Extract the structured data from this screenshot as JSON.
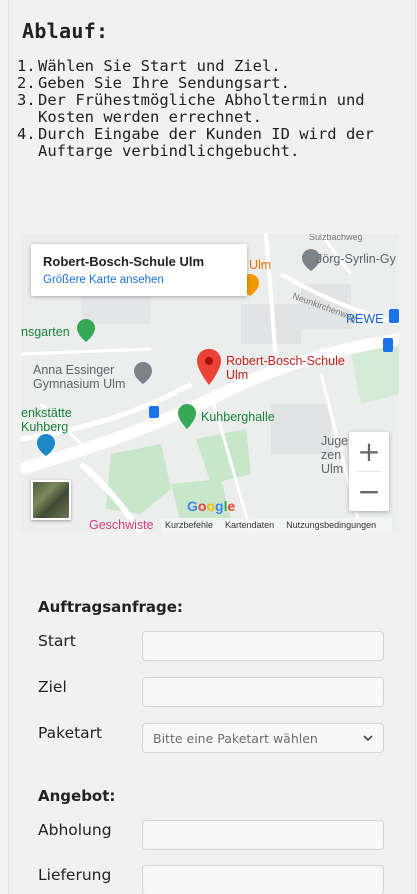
{
  "ablauf": {
    "title": "Ablauf:",
    "steps": [
      {
        "num": "1.",
        "text": "Wählen Sie Start und Ziel."
      },
      {
        "num": "2.",
        "text": "Geben Sie Ihre Sendungsart."
      },
      {
        "num": "3.",
        "text": "Der Frühestmögliche Abholtermin und Kosten werden errechnet."
      },
      {
        "num": "4.",
        "text": "Durch Eingabe der Kunden ID wird der Auftarge verbindlichgebucht."
      }
    ]
  },
  "map": {
    "place_name": "Robert-Bosch-Schule Ulm",
    "larger_map_link": "Größere Karte ansehen",
    "marker_label_line1": "Robert-Bosch-Schule",
    "marker_label_line2": "Ulm",
    "labels": {
      "joerg": "Jörg-Syrlin-Gy",
      "neunkirchenweg": "Neunkirchenweg",
      "rewe": "REWE",
      "ulm_orange": "Ulm",
      "sgarten": "nsgarten",
      "anna1": "Anna Essinger",
      "anna2": "Gymnasium Ulm",
      "kuhberghalle": "Kuhberghalle",
      "statte1": "enkstätte",
      "statte2": "Kuhberg",
      "jug1": "Juge",
      "jug2": "zen",
      "jug3": "Ulm",
      "geschwister": "Geschwiste",
      "sulzbachweg": "Sulzbachweg"
    },
    "zoom_in": "+",
    "zoom_out": "−",
    "google_logo": "Google",
    "attribution": {
      "shortcuts": "Kurzbefehle",
      "map_data": "Kartendaten",
      "terms": "Nutzungsbedingungen"
    }
  },
  "form": {
    "request_title": "Auftragsanfrage:",
    "start_label": "Start",
    "start_value": "",
    "ziel_label": "Ziel",
    "ziel_value": "",
    "paketart_label": "Paketart",
    "paketart_selected": "Bitte eine Paketart wählen",
    "offer_title": "Angebot:",
    "abholung_label": "Abholung",
    "abholung_value": "",
    "lieferung_label": "Lieferung",
    "lieferung_value": ""
  },
  "colors": {
    "link_blue": "#1a73e8",
    "marker_red": "#ea4335",
    "park_green": "#34a853"
  }
}
